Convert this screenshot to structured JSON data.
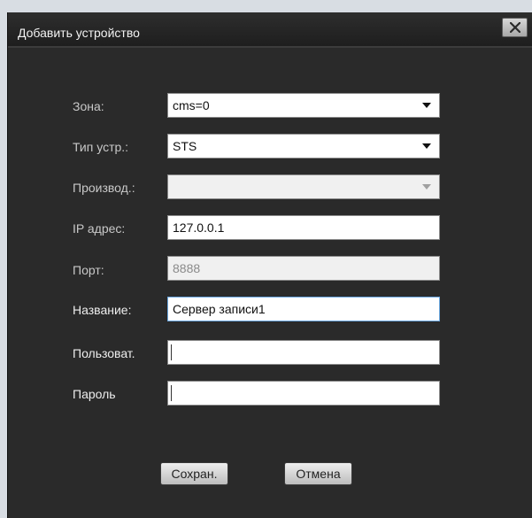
{
  "dialog": {
    "title": "Добавить устройство",
    "close_icon": "close-icon"
  },
  "form": {
    "zone": {
      "label": "Зона:",
      "value": "cms=0"
    },
    "device_type": {
      "label": "Тип устр.:",
      "value": "STS"
    },
    "manufacturer": {
      "label": "Производ.:",
      "value": ""
    },
    "ip": {
      "label": "IP адрес:",
      "value": "127.0.0.1"
    },
    "port": {
      "label": "Порт:",
      "value": "8888"
    },
    "name": {
      "label": "Название:",
      "value": "Сервер записи1"
    },
    "user": {
      "label": "Пользоват.",
      "value": ""
    },
    "password": {
      "label": "Пароль",
      "value": ""
    }
  },
  "buttons": {
    "save": "Сохран.",
    "cancel": "Отмена"
  },
  "colors": {
    "dialog_bg": "#2a2a2a",
    "focus_border": "#6aa7e0"
  }
}
